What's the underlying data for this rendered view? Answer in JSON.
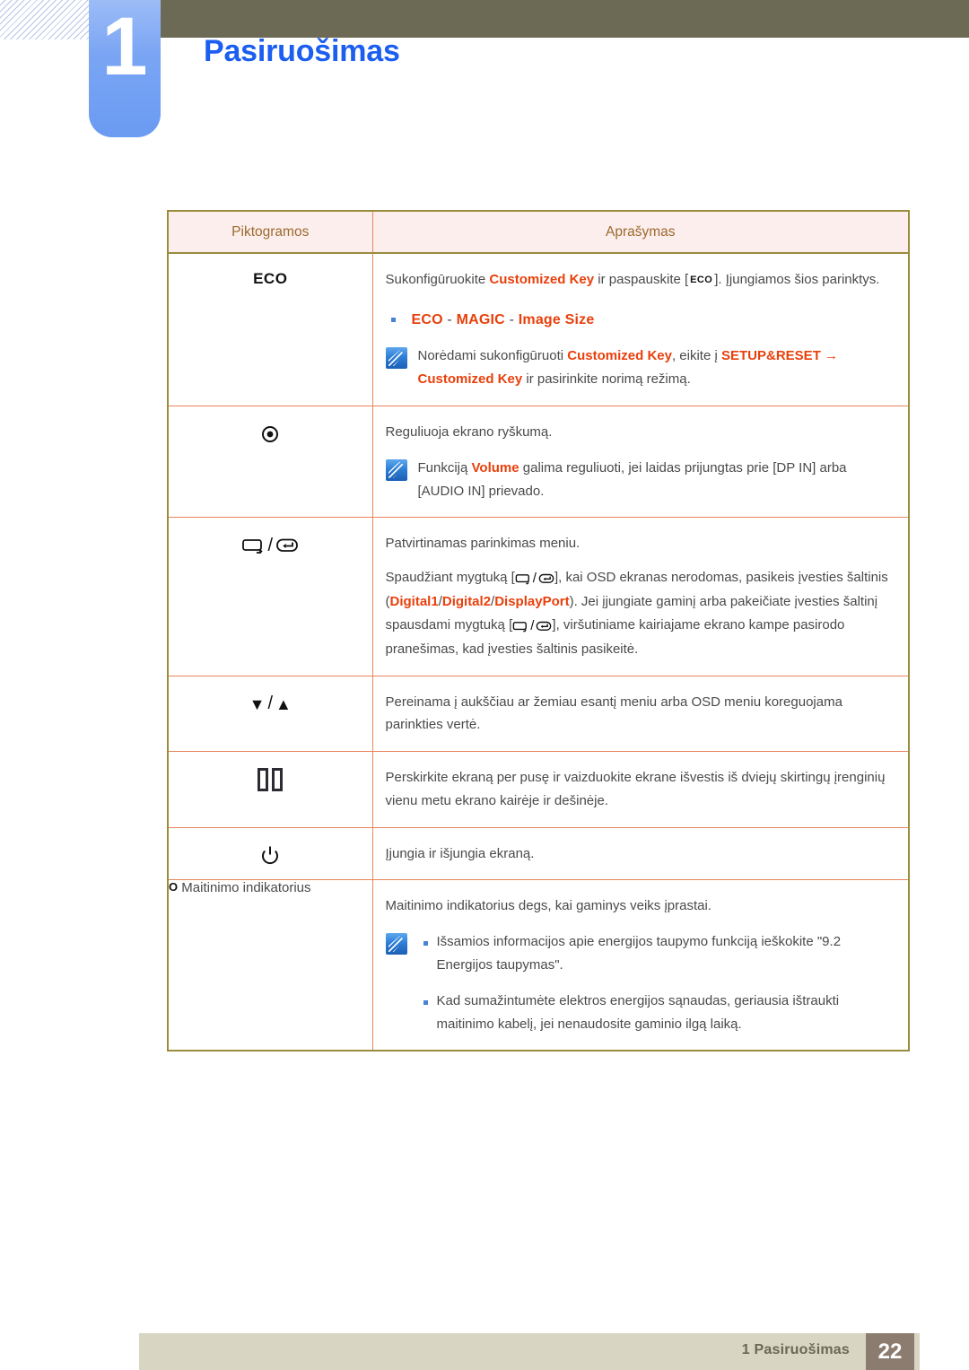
{
  "header": {
    "chapter_number": "1",
    "title": "Pasiruošimas",
    "band_color": "#6c6a55",
    "tab_color": "#7aa5f4",
    "title_color": "#1b5ef0"
  },
  "table": {
    "columns": [
      "Piktogramos",
      "Aprašymas"
    ],
    "rows": [
      {
        "icon_name": "eco-label",
        "icon_text": "ECO",
        "desc_lead_1": "Sukonfigūruokite ",
        "desc_hl_1": "Customized Key",
        "desc_lead_2": " ir paspauskite [",
        "desc_badge": "ECO",
        "desc_lead_3": "]. Įjungiamos šios parinktys.",
        "option_parts": [
          "ECO",
          "MAGIC",
          "Image Size"
        ],
        "option_sep": " - ",
        "note_lead_1": "Norėdami sukonfigūruoti ",
        "note_hl_1": "Customized Key",
        "note_lead_2": ", eikite į ",
        "note_hl_2": "SETUP&RESET",
        "note_lead_3": " → ",
        "note_hl_3": "Customized Key",
        "note_lead_4": " ir pasirinkite norimą režimą."
      },
      {
        "icon_name": "circle-dot-icon",
        "desc_main": "Reguliuoja ekrano ryškumą.",
        "note_lead_1": "Funkciją ",
        "note_hl_1": "Volume",
        "note_lead_2": "  galima reguliuoti, jei laidas prijungtas prie [DP IN] arba [AUDIO IN] prievado."
      },
      {
        "icon_name": "source-enter-icon",
        "desc_main": "Patvirtinamas parinkimas meniu.",
        "p_1": "Spaudžiant mygtuką [",
        "p_2": "], kai OSD ekranas nerodomas, pasikeis įvesties šaltinis (",
        "hl_a": "Digital1",
        "hl_b": "Digital2",
        "hl_c": "DisplayPort",
        "p_3": "). Jei įjungiate gaminį arba pakeičiate įvesties šaltinį spausdami mygtuką [",
        "p_4": "], viršutiniame kairiajame ekrano kampe pasirodo pranešimas, kad įvesties šaltinis pasikeitė."
      },
      {
        "icon_name": "down-up-arrows-icon",
        "desc_main": "Pereinama į aukščiau ar žemiau esantį meniu arba OSD meniu koreguojama parinkties vertė."
      },
      {
        "icon_name": "pip-split-screen-icon",
        "desc_main": "Perskirkite ekraną per pusę ir vaizduokite ekrane išvestis iš dviejų skirtingų įrenginių vienu metu ekrano kairėje ir dešinėje."
      },
      {
        "icon_name": "power-icon",
        "desc_main": "Įjungia ir išjungia ekraną."
      },
      {
        "icon_name": "power-indicator-label",
        "icon_text": "Maitinimo indikatorius",
        "icon_marker": "O",
        "desc_main": "Maitinimo indikatorius degs, kai gaminys veiks įprastai.",
        "note_bullets": [
          "Išsamios informacijos apie energijos taupymo funkciją ieškokite \"9.2 Energijos taupymas\".",
          "Kad sumažintumėte elektros energijos sąnaudas, geriausia ištraukti maitinimo kabelį, jei nenaudosite gaminio ilgą laiką."
        ]
      }
    ]
  },
  "footer": {
    "label": "1 Pasiruošimas",
    "page_number": "22",
    "bar_color": "#d9d5c3",
    "page_block_color": "#8b7c6f"
  }
}
